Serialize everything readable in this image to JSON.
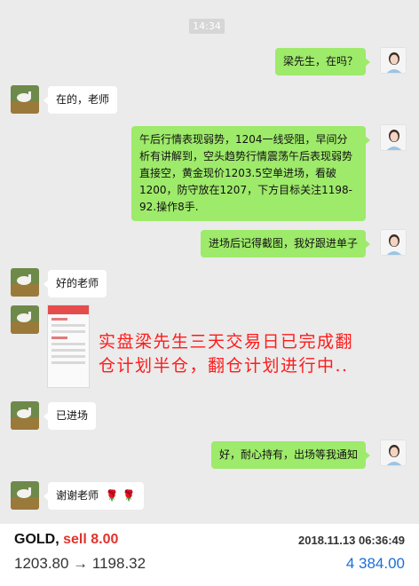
{
  "chat": {
    "timestamp": "14:34",
    "messages": [
      {
        "side": "right",
        "text": "梁先生，在吗？"
      },
      {
        "side": "left",
        "text": "在的，老师"
      },
      {
        "side": "right",
        "text": "午后行情表现弱势，1204一线受阻，早间分析有讲解到，空头趋势行情震荡午后表现弱势直接空，黄金现价1203.5空单进场，看破1200，防守放在1207，下方目标关注1198-92.操作8手."
      },
      {
        "side": "right",
        "text": "进场后记得截图，我好跟进单子"
      },
      {
        "side": "left",
        "text": "好的老师"
      },
      {
        "side": "left",
        "text": "已进场"
      },
      {
        "side": "right",
        "text": "好，耐心持有，出场等我通知"
      },
      {
        "side": "left",
        "text": "谢谢老师"
      }
    ],
    "rose_emoji": "🌹 🌹"
  },
  "overlay": {
    "line1": "实盘梁先生三天交易日已完成翻",
    "line2": "仓计划半仓，翻仓计划进行中.."
  },
  "ticker": {
    "symbol": "GOLD,",
    "action": "sell 8.00",
    "datetime": "2018.11.13 06:36:49",
    "price_move": "1203.80 → 1198.32",
    "profit": "4 384.00"
  },
  "colors": {
    "bubble_green": "#9eea6a",
    "sell_red": "#e0342c",
    "profit_blue": "#1a6fd6",
    "overlay_red": "#ff1a1a"
  }
}
